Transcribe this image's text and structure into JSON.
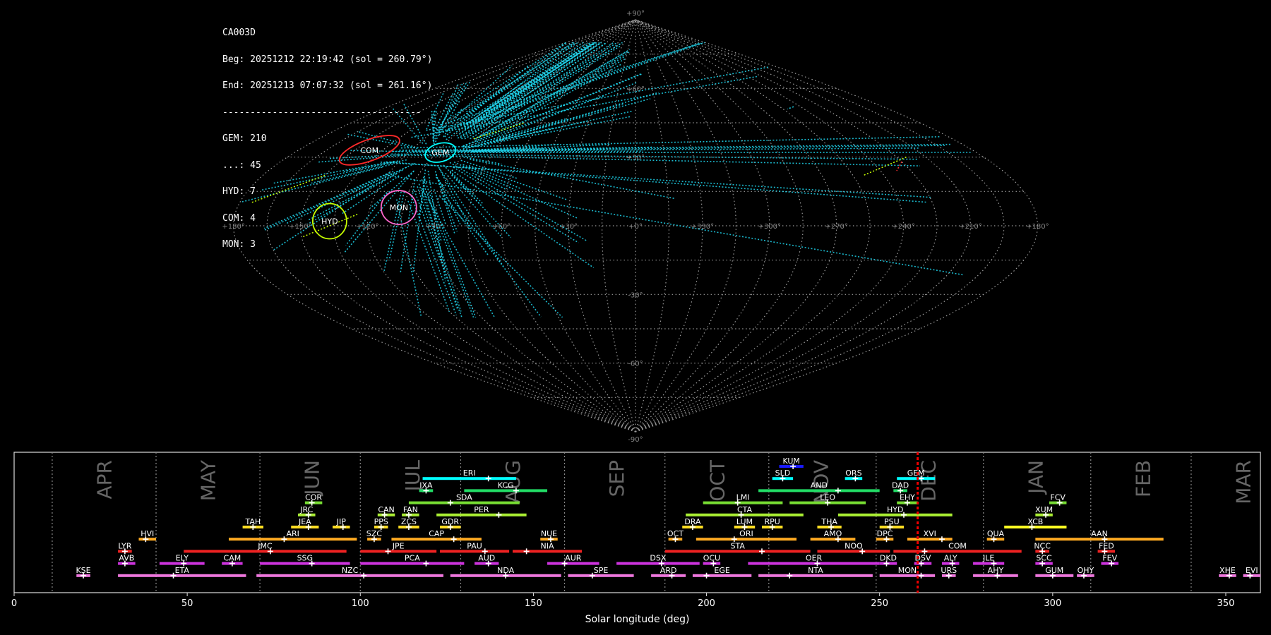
{
  "info": {
    "station": "CA003D",
    "beg": "Beg: 20251212 22:19:42 (sol = 260.79°)",
    "end": "End: 20251213 07:07:32 (sol = 261.16°)",
    "separator": "------------------------------------",
    "counts": [
      "GEM: 210",
      "...: 45",
      "HYD: 7",
      "COM: 4",
      "MON: 3"
    ]
  },
  "chart_data": [
    {
      "type": "scatter",
      "projection": "sinusoidal sky map",
      "lon_ticks": [
        "+180°",
        "+150°",
        "+120°",
        "+90°",
        "+60°",
        "+30°",
        "+0°",
        "+330°",
        "+300°",
        "+270°",
        "+240°",
        "+210°",
        "+180°"
      ],
      "lat_ticks": [
        "+90°",
        "+60°",
        "+30°",
        "-30°",
        "-60°",
        "-90°"
      ],
      "radiants": [
        {
          "name": "GEM",
          "lon": 103,
          "lat": 32,
          "color": "#00ffff",
          "count": 210
        },
        {
          "name": "COM",
          "lon": 142,
          "lat": 33,
          "color": "#ff2a2a",
          "count": 4
        },
        {
          "name": "HYD",
          "lon": 137,
          "lat": 2,
          "color": "#c8ff00",
          "count": 7
        },
        {
          "name": "MON",
          "lon": 107,
          "lat": 8,
          "color": "#ff66cc",
          "count": 3
        }
      ],
      "grid": true
    },
    {
      "type": "bar",
      "orientation": "horizontal-ranges",
      "xlabel": "Solar longitude (deg)",
      "xlim": [
        0,
        360
      ],
      "xticks": [
        0,
        50,
        100,
        150,
        200,
        250,
        300,
        350
      ],
      "current_sol": 261.0,
      "months": [
        {
          "name": "APR",
          "sol": 11
        },
        {
          "name": "MAY",
          "sol": 41
        },
        {
          "name": "JUN",
          "sol": 71
        },
        {
          "name": "JUL",
          "sol": 100
        },
        {
          "name": "AUG",
          "sol": 129
        },
        {
          "name": "SEP",
          "sol": 159
        },
        {
          "name": "OCT",
          "sol": 188
        },
        {
          "name": "NOV",
          "sol": 218
        },
        {
          "name": "DEC",
          "sol": 249
        },
        {
          "name": "JAN",
          "sol": 280
        },
        {
          "name": "FEB",
          "sol": 311
        },
        {
          "name": "MAR",
          "sol": 340
        }
      ],
      "showers": [
        {
          "code": "KUM",
          "start": 221,
          "end": 228,
          "peak": 225,
          "row": 10,
          "color": "#1a1aff"
        },
        {
          "code": "ERI",
          "start": 118,
          "end": 145,
          "peak": 137,
          "row": 9,
          "color": "#00ffff"
        },
        {
          "code": "SLD",
          "start": 219,
          "end": 225,
          "peak": 222,
          "row": 9,
          "color": "#00ffff"
        },
        {
          "code": "ORS",
          "start": 240,
          "end": 245,
          "peak": 243,
          "row": 9,
          "color": "#00ffff"
        },
        {
          "code": "GEM",
          "start": 255,
          "end": 266,
          "peak": 262,
          "row": 9,
          "color": "#00ffff"
        },
        {
          "code": "IXA",
          "start": 117,
          "end": 121,
          "peak": 119,
          "row": 8,
          "color": "#22dd66"
        },
        {
          "code": "KCG",
          "start": 130,
          "end": 154,
          "peak": 145,
          "row": 8,
          "color": "#22dd66"
        },
        {
          "code": "AND",
          "start": 215,
          "end": 250,
          "peak": 238,
          "row": 8,
          "color": "#22dd66"
        },
        {
          "code": "DAD",
          "start": 254,
          "end": 258,
          "peak": 256,
          "row": 8,
          "color": "#22dd66"
        },
        {
          "code": "COR",
          "start": 84,
          "end": 89,
          "peak": 86,
          "row": 7,
          "color": "#77dd33"
        },
        {
          "code": "SDA",
          "start": 114,
          "end": 146,
          "peak": 126,
          "row": 7,
          "color": "#77dd33"
        },
        {
          "code": "LMI",
          "start": 199,
          "end": 222,
          "peak": 209,
          "row": 7,
          "color": "#77dd33"
        },
        {
          "code": "LEO",
          "start": 224,
          "end": 246,
          "peak": 235,
          "row": 7,
          "color": "#77dd33"
        },
        {
          "code": "EHY",
          "start": 255,
          "end": 261,
          "peak": 258,
          "row": 7,
          "color": "#77dd33"
        },
        {
          "code": "FCV",
          "start": 299,
          "end": 304,
          "peak": 302,
          "row": 7,
          "color": "#77dd33"
        },
        {
          "code": "JRC",
          "start": 82,
          "end": 87,
          "peak": 85,
          "row": 6,
          "color": "#aaee33"
        },
        {
          "code": "CAN",
          "start": 105,
          "end": 110,
          "peak": 107,
          "row": 6,
          "color": "#aaee33"
        },
        {
          "code": "FAN",
          "start": 112,
          "end": 117,
          "peak": 114,
          "row": 6,
          "color": "#aaee33"
        },
        {
          "code": "PER",
          "start": 122,
          "end": 148,
          "peak": 140,
          "row": 6,
          "color": "#aaee33"
        },
        {
          "code": "CTA",
          "start": 194,
          "end": 228,
          "peak": 210,
          "row": 6,
          "color": "#aaee33"
        },
        {
          "code": "HYD",
          "start": 238,
          "end": 271,
          "peak": 257,
          "row": 6,
          "color": "#aaee33"
        },
        {
          "code": "XUM",
          "start": 295,
          "end": 300,
          "peak": 298,
          "row": 6,
          "color": "#aaee33"
        },
        {
          "code": "TAH",
          "start": 66,
          "end": 72,
          "peak": 69,
          "row": 5,
          "color": "#ffdd22"
        },
        {
          "code": "JEA",
          "start": 80,
          "end": 88,
          "peak": 85,
          "row": 5,
          "color": "#ffdd22"
        },
        {
          "code": "JIP",
          "start": 92,
          "end": 97,
          "peak": 95,
          "row": 5,
          "color": "#ffdd22"
        },
        {
          "code": "PPS",
          "start": 104,
          "end": 108,
          "peak": 106,
          "row": 5,
          "color": "#ffdd22"
        },
        {
          "code": "ZCS",
          "start": 111,
          "end": 117,
          "peak": 114,
          "row": 5,
          "color": "#ffdd22"
        },
        {
          "code": "GDR",
          "start": 123,
          "end": 129,
          "peak": 126,
          "row": 5,
          "color": "#ffdd22"
        },
        {
          "code": "DRA",
          "start": 193,
          "end": 199,
          "peak": 196,
          "row": 5,
          "color": "#ffdd22"
        },
        {
          "code": "LUM",
          "start": 208,
          "end": 214,
          "peak": 211,
          "row": 5,
          "color": "#ffdd22"
        },
        {
          "code": "RPU",
          "start": 216,
          "end": 222,
          "peak": 219,
          "row": 5,
          "color": "#ffdd22"
        },
        {
          "code": "THA",
          "start": 232,
          "end": 239,
          "peak": 236,
          "row": 5,
          "color": "#ffdd22"
        },
        {
          "code": "PSU",
          "start": 250,
          "end": 257,
          "peak": 253,
          "row": 5,
          "color": "#ffdd22"
        },
        {
          "code": "XCB",
          "start": 286,
          "end": 304,
          "peak": 294,
          "row": 5,
          "color": "#ffff22"
        },
        {
          "code": "HVI",
          "start": 36,
          "end": 41,
          "peak": 38,
          "row": 4,
          "color": "#ffaa22"
        },
        {
          "code": "ARI",
          "start": 62,
          "end": 99,
          "peak": 78,
          "row": 4,
          "color": "#ffaa22"
        },
        {
          "code": "SZC",
          "start": 102,
          "end": 106,
          "peak": 104,
          "row": 4,
          "color": "#ffaa22"
        },
        {
          "code": "CAP",
          "start": 109,
          "end": 135,
          "peak": 127,
          "row": 4,
          "color": "#ffaa22"
        },
        {
          "code": "NUE",
          "start": 152,
          "end": 157,
          "peak": 155,
          "row": 4,
          "color": "#ffaa22"
        },
        {
          "code": "OCT",
          "start": 189,
          "end": 193,
          "peak": 191,
          "row": 4,
          "color": "#ffaa22"
        },
        {
          "code": "ORI",
          "start": 197,
          "end": 226,
          "peak": 208,
          "row": 4,
          "color": "#ffaa22"
        },
        {
          "code": "AMO",
          "start": 230,
          "end": 243,
          "peak": 238,
          "row": 4,
          "color": "#ffaa22"
        },
        {
          "code": "DPC",
          "start": 249,
          "end": 254,
          "peak": 252,
          "row": 4,
          "color": "#ffaa22"
        },
        {
          "code": "XVI",
          "start": 258,
          "end": 271,
          "peak": 268,
          "row": 4,
          "color": "#ffaa22"
        },
        {
          "code": "QUA",
          "start": 281,
          "end": 286,
          "peak": 283,
          "row": 4,
          "color": "#ffaa22"
        },
        {
          "code": "AAN",
          "start": 295,
          "end": 332,
          "peak": 315,
          "row": 4,
          "color": "#ffaa22"
        },
        {
          "code": "LYR",
          "start": 30,
          "end": 34,
          "peak": 32,
          "row": 3,
          "color": "#ee2222"
        },
        {
          "code": "JMC",
          "start": 49,
          "end": 96,
          "peak": 74,
          "row": 3,
          "color": "#ee2222"
        },
        {
          "code": "JPE",
          "start": 100,
          "end": 122,
          "peak": 108,
          "row": 3,
          "color": "#ee2222"
        },
        {
          "code": "PAU",
          "start": 123,
          "end": 143,
          "peak": 136,
          "row": 3,
          "color": "#ee2222"
        },
        {
          "code": "NIA",
          "start": 144,
          "end": 164,
          "peak": 148,
          "row": 3,
          "color": "#ee2222"
        },
        {
          "code": "STA",
          "start": 188,
          "end": 230,
          "peak": 216,
          "row": 3,
          "color": "#ee2222"
        },
        {
          "code": "NOO",
          "start": 232,
          "end": 253,
          "peak": 245,
          "row": 3,
          "color": "#ee2222"
        },
        {
          "code": "COM",
          "start": 254,
          "end": 291,
          "peak": 263,
          "row": 3,
          "color": "#ee2222"
        },
        {
          "code": "NCC",
          "start": 295,
          "end": 299,
          "peak": 297,
          "row": 3,
          "color": "#ee2222"
        },
        {
          "code": "FED",
          "start": 313,
          "end": 318,
          "peak": 315,
          "row": 3,
          "color": "#ee2222"
        },
        {
          "code": "AVB",
          "start": 30,
          "end": 35,
          "peak": 32,
          "row": 2,
          "color": "#cc33dd"
        },
        {
          "code": "ELY",
          "start": 42,
          "end": 55,
          "peak": 49,
          "row": 2,
          "color": "#cc33dd"
        },
        {
          "code": "CAM",
          "start": 60,
          "end": 66,
          "peak": 63,
          "row": 2,
          "color": "#cc33dd"
        },
        {
          "code": "SSG",
          "start": 71,
          "end": 97,
          "peak": 86,
          "row": 2,
          "color": "#cc33dd"
        },
        {
          "code": "PCA",
          "start": 100,
          "end": 130,
          "peak": 119,
          "row": 2,
          "color": "#cc33dd"
        },
        {
          "code": "AUD",
          "start": 133,
          "end": 140,
          "peak": 137,
          "row": 2,
          "color": "#cc33dd"
        },
        {
          "code": "AUR",
          "start": 154,
          "end": 169,
          "peak": 159,
          "row": 2,
          "color": "#cc33dd"
        },
        {
          "code": "DSX",
          "start": 174,
          "end": 198,
          "peak": 187,
          "row": 2,
          "color": "#cc33dd"
        },
        {
          "code": "OCU",
          "start": 199,
          "end": 204,
          "peak": 202,
          "row": 2,
          "color": "#cc33dd"
        },
        {
          "code": "OER",
          "start": 212,
          "end": 250,
          "peak": 232,
          "row": 2,
          "color": "#cc33dd"
        },
        {
          "code": "DKD",
          "start": 250,
          "end": 255,
          "peak": 252,
          "row": 2,
          "color": "#cc33dd"
        },
        {
          "code": "DSV",
          "start": 260,
          "end": 265,
          "peak": 262,
          "row": 2,
          "color": "#cc33dd"
        },
        {
          "code": "ALY",
          "start": 268,
          "end": 273,
          "peak": 271,
          "row": 2,
          "color": "#cc33dd"
        },
        {
          "code": "JLE",
          "start": 277,
          "end": 286,
          "peak": 283,
          "row": 2,
          "color": "#cc33dd"
        },
        {
          "code": "SCC",
          "start": 295,
          "end": 300,
          "peak": 297,
          "row": 2,
          "color": "#cc33dd"
        },
        {
          "code": "FEV",
          "start": 314,
          "end": 319,
          "peak": 317,
          "row": 2,
          "color": "#cc33dd"
        },
        {
          "code": "KSE",
          "start": 18,
          "end": 22,
          "peak": 20,
          "row": 1,
          "color": "#ee77dd"
        },
        {
          "code": "ETA",
          "start": 30,
          "end": 67,
          "peak": 46,
          "row": 1,
          "color": "#ee77dd"
        },
        {
          "code": "NZC",
          "start": 70,
          "end": 124,
          "peak": 101,
          "row": 1,
          "color": "#ee77dd"
        },
        {
          "code": "NDA",
          "start": 126,
          "end": 158,
          "peak": 142,
          "row": 1,
          "color": "#ee77dd"
        },
        {
          "code": "SPE",
          "start": 160,
          "end": 179,
          "peak": 167,
          "row": 1,
          "color": "#ee77dd"
        },
        {
          "code": "ARD",
          "start": 184,
          "end": 194,
          "peak": 190,
          "row": 1,
          "color": "#ee77dd"
        },
        {
          "code": "EGE",
          "start": 196,
          "end": 213,
          "peak": 200,
          "row": 1,
          "color": "#ee77dd"
        },
        {
          "code": "NTA",
          "start": 215,
          "end": 248,
          "peak": 224,
          "row": 1,
          "color": "#ee77dd"
        },
        {
          "code": "MON",
          "start": 250,
          "end": 266,
          "peak": 262,
          "row": 1,
          "color": "#ee77dd"
        },
        {
          "code": "URS",
          "start": 268,
          "end": 272,
          "peak": 270,
          "row": 1,
          "color": "#ee77dd"
        },
        {
          "code": "AHY",
          "start": 277,
          "end": 290,
          "peak": 284,
          "row": 1,
          "color": "#ee77dd"
        },
        {
          "code": "GUM",
          "start": 295,
          "end": 306,
          "peak": 300,
          "row": 1,
          "color": "#ee77dd"
        },
        {
          "code": "OHY",
          "start": 307,
          "end": 312,
          "peak": 309,
          "row": 1,
          "color": "#ee77dd"
        },
        {
          "code": "XHE",
          "start": 348,
          "end": 353,
          "peak": 351,
          "row": 1,
          "color": "#ee77dd"
        },
        {
          "code": "EVI",
          "start": 355,
          "end": 360,
          "peak": 357,
          "row": 1,
          "color": "#ee77dd"
        }
      ]
    }
  ]
}
